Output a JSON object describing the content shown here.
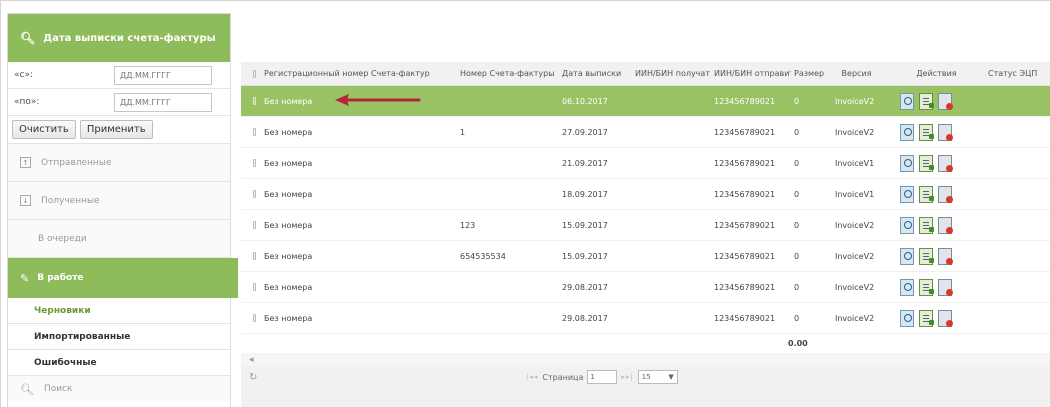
{
  "sidebar": {
    "filter_title": "Дата выписки счета-фактуры",
    "from_label": "«с»:",
    "from_placeholder": "ДД.ММ.ГГГГ",
    "to_label": "«по»:",
    "to_placeholder": "ДД.ММ.ГГГГ",
    "clear_label": "Очистить",
    "apply_label": "Применить",
    "sent_label": "Отправленные",
    "received_label": "Полученные",
    "queue_label": "В очереди",
    "in_work_label": "В работе",
    "drafts_label": "Черновики",
    "imported_label": "Импортированные",
    "errors_label": "Ошибочные",
    "search_label": "Поиск"
  },
  "table": {
    "headers": [
      "Регистрационный номер Счета-фактур",
      "Номер Счета-фактуры",
      "Дата выписки",
      "ИИН/БИН получат",
      "ИИН/БИН отправит",
      "Размер с",
      "Версия",
      "Действия",
      "Статус ЭЦП"
    ],
    "rows": [
      {
        "reg": "Без номера",
        "num": "",
        "date": "06.10.2017",
        "recv": "",
        "send": "123456789021",
        "size": "0",
        "version": "InvoiceV2",
        "selected": true
      },
      {
        "reg": "Без номера",
        "num": "1",
        "date": "27.09.2017",
        "recv": "",
        "send": "123456789021",
        "size": "0",
        "version": "InvoiceV2",
        "selected": false
      },
      {
        "reg": "Без номера",
        "num": "",
        "date": "21.09.2017",
        "recv": "",
        "send": "123456789021",
        "size": "0",
        "version": "InvoiceV1",
        "selected": false
      },
      {
        "reg": "Без номера",
        "num": "",
        "date": "18.09.2017",
        "recv": "",
        "send": "123456789021",
        "size": "0",
        "version": "InvoiceV1",
        "selected": false
      },
      {
        "reg": "Без номера",
        "num": "123",
        "date": "15.09.2017",
        "recv": "",
        "send": "123456789021",
        "size": "0",
        "version": "InvoiceV2",
        "selected": false
      },
      {
        "reg": "Без номера",
        "num": "654535534",
        "date": "15.09.2017",
        "recv": "",
        "send": "123456789021",
        "size": "0",
        "version": "InvoiceV2",
        "selected": false
      },
      {
        "reg": "Без номера",
        "num": "",
        "date": "29.08.2017",
        "recv": "",
        "send": "123456789021",
        "size": "0",
        "version": "InvoiceV2",
        "selected": false
      },
      {
        "reg": "Без номера",
        "num": "",
        "date": "29.08.2017",
        "recv": "",
        "send": "123456789021",
        "size": "0",
        "version": "InvoiceV2",
        "selected": false
      }
    ],
    "total": "0.00"
  },
  "pager": {
    "page_label": "Страница",
    "page_value": "1",
    "page_size": "15"
  },
  "colors": {
    "accent": "#8fbc5b",
    "selected_row": "#99c265",
    "annotation_arrow": "#b3263a"
  }
}
